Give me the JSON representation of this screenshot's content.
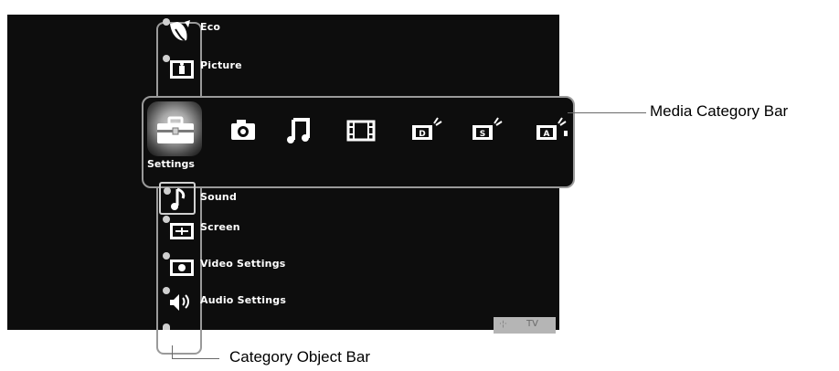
{
  "category_object_bar": {
    "items_above": [
      {
        "label": "Eco",
        "icon": "eco-icon"
      },
      {
        "label": "Picture",
        "icon": "picture-icon"
      }
    ],
    "items_below": [
      {
        "label": "Sound",
        "icon": "sound-icon",
        "selected": true
      },
      {
        "label": "Screen",
        "icon": "screen-icon"
      },
      {
        "label": "Video Settings",
        "icon": "video-settings-icon"
      },
      {
        "label": "Audio Settings",
        "icon": "audio-settings-icon"
      }
    ]
  },
  "media_category_bar": {
    "selected_label": "Settings",
    "items": [
      "settings-icon",
      "photo-icon",
      "music-icon",
      "video-icon",
      "digital-tv-icon",
      "satellite-tv-icon",
      "analog-tv-icon"
    ]
  },
  "tv_badge": {
    "label": "TV"
  },
  "callouts": {
    "media_category_bar": "Media Category Bar",
    "category_object_bar": "Category Object Bar"
  },
  "colors": {
    "screen_bg": "#0d0d0d",
    "frame": "#9a9a9a",
    "text": "#ffffff"
  }
}
